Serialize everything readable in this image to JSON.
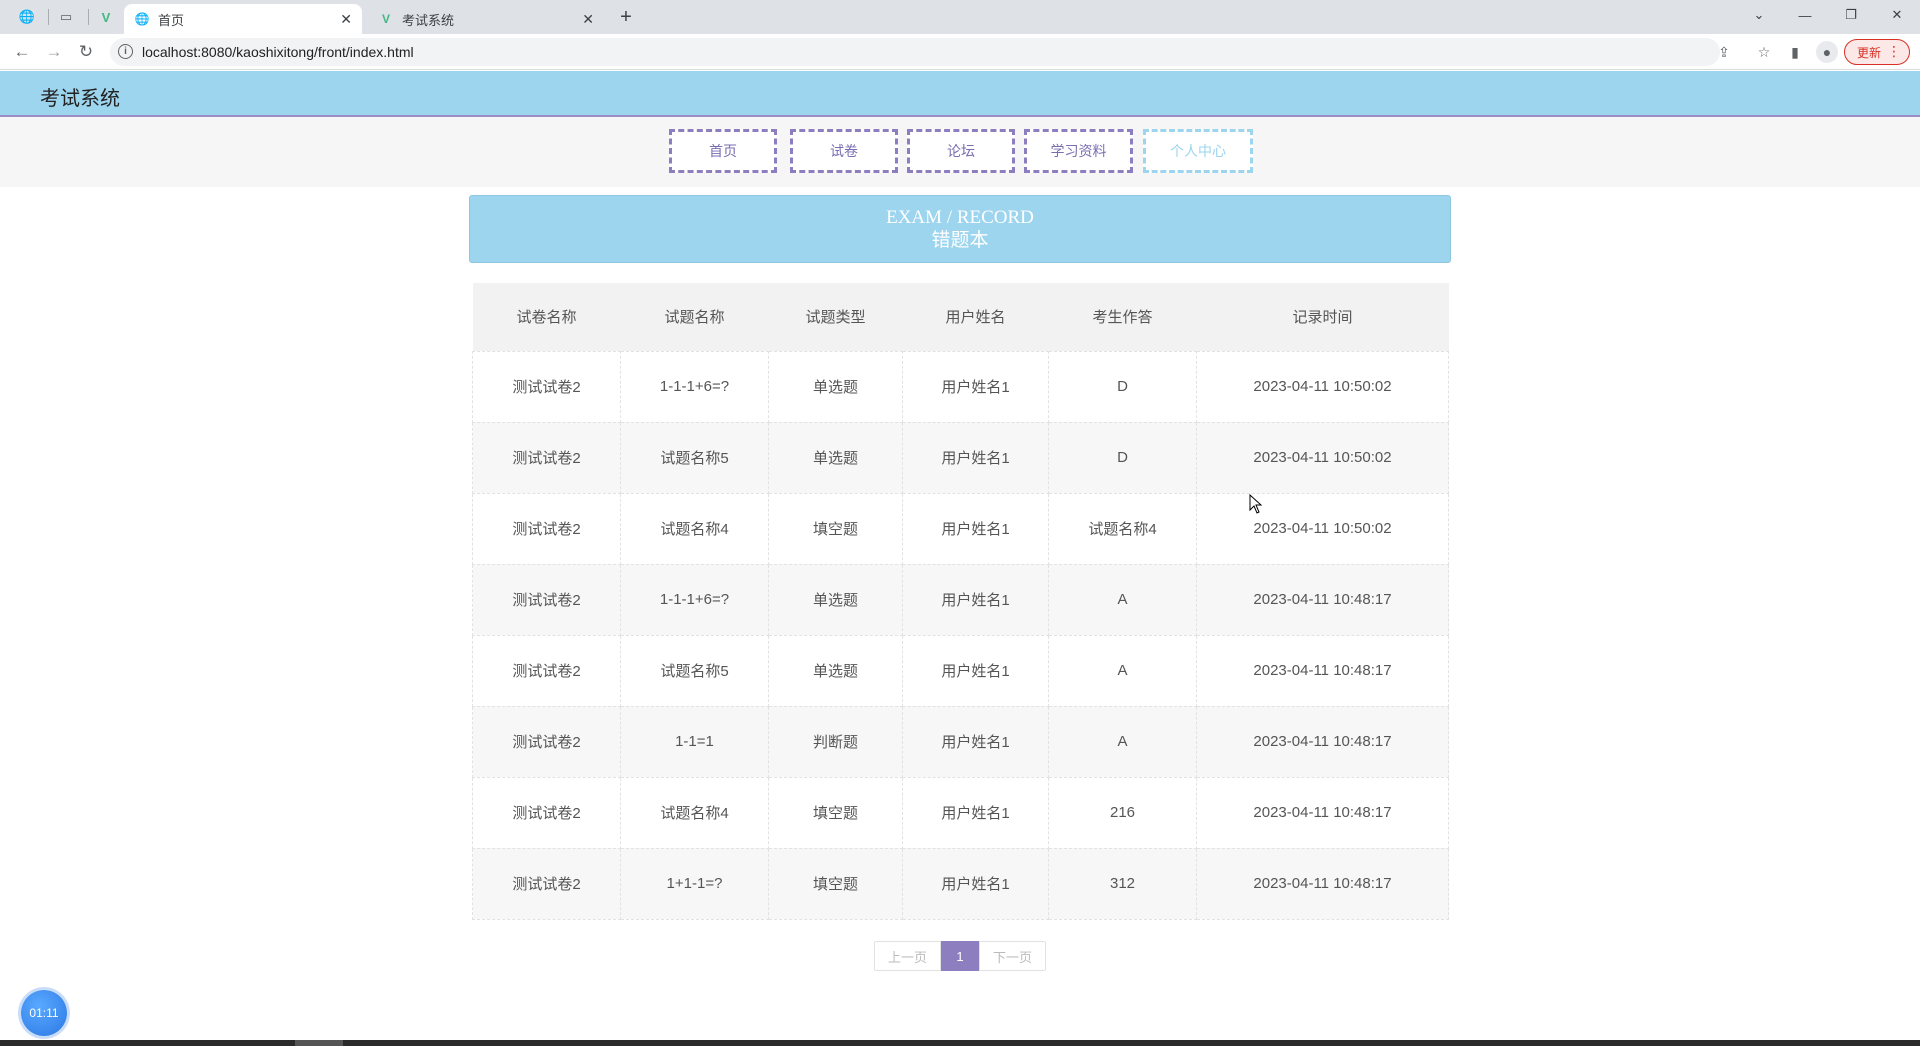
{
  "browser": {
    "tabs": [
      {
        "title": "首页",
        "active": true
      },
      {
        "title": "考试系统",
        "active": false
      }
    ],
    "url": "localhost:8080/kaoshixitong/front/index.html",
    "update_label": "更新"
  },
  "site": {
    "title": "考试系统",
    "menu": [
      {
        "label": "首页",
        "active": false
      },
      {
        "label": "试卷",
        "active": false
      },
      {
        "label": "论坛",
        "active": false
      },
      {
        "label": "学习资料",
        "active": false
      },
      {
        "label": "个人中心",
        "active": true
      }
    ]
  },
  "section": {
    "title_en": "EXAM / RECORD",
    "title_zh": "错题本"
  },
  "table": {
    "headers": [
      "试卷名称",
      "试题名称",
      "试题类型",
      "用户姓名",
      "考生作答",
      "记录时间"
    ],
    "rows": [
      [
        "测试试卷2",
        "1-1-1+6=?",
        "单选题",
        "用户姓名1",
        "D",
        "2023-04-11 10:50:02"
      ],
      [
        "测试试卷2",
        "试题名称5",
        "单选题",
        "用户姓名1",
        "D",
        "2023-04-11 10:50:02"
      ],
      [
        "测试试卷2",
        "试题名称4",
        "填空题",
        "用户姓名1",
        "试题名称4",
        "2023-04-11 10:50:02"
      ],
      [
        "测试试卷2",
        "1-1-1+6=?",
        "单选题",
        "用户姓名1",
        "A",
        "2023-04-11 10:48:17"
      ],
      [
        "测试试卷2",
        "试题名称5",
        "单选题",
        "用户姓名1",
        "A",
        "2023-04-11 10:48:17"
      ],
      [
        "测试试卷2",
        "1-1=1",
        "判断题",
        "用户姓名1",
        "A",
        "2023-04-11 10:48:17"
      ],
      [
        "测试试卷2",
        "试题名称4",
        "填空题",
        "用户姓名1",
        "216",
        "2023-04-11 10:48:17"
      ],
      [
        "测试试卷2",
        "1+1-1=?",
        "填空题",
        "用户姓名1",
        "312",
        "2023-04-11 10:48:17"
      ]
    ]
  },
  "pager": {
    "prev_label": "上一页",
    "current": "1",
    "next_label": "下一页"
  },
  "timer": "01:11"
}
